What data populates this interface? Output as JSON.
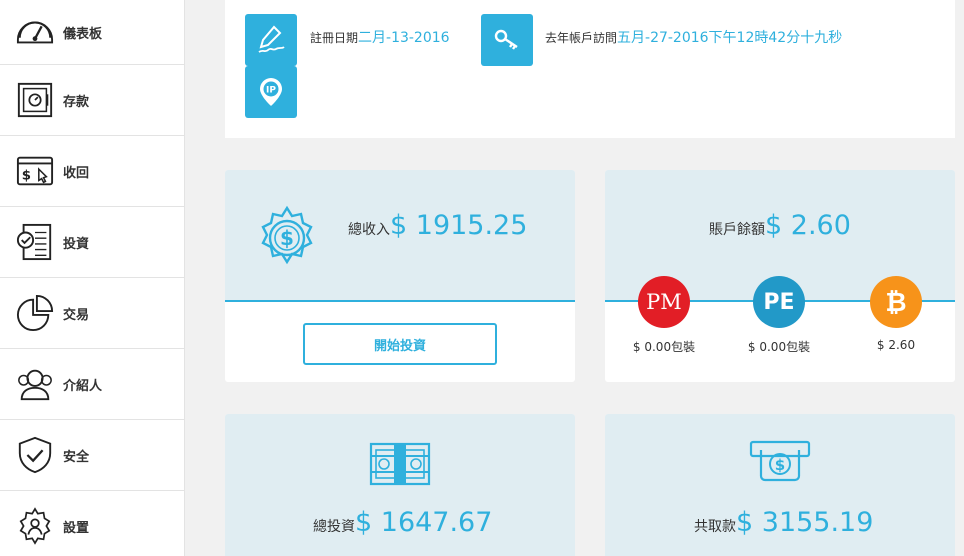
{
  "sidebar": {
    "items": [
      {
        "label": "儀表板",
        "icon": "speedometer-icon"
      },
      {
        "label": "存款",
        "icon": "safe-icon"
      },
      {
        "label": "收回",
        "icon": "withdraw-icon"
      },
      {
        "label": "投資",
        "icon": "checklist-icon"
      },
      {
        "label": "交易",
        "icon": "pie-chart-icon"
      },
      {
        "label": "介紹人",
        "icon": "users-icon"
      },
      {
        "label": "安全",
        "icon": "shield-check-icon"
      },
      {
        "label": "設置",
        "icon": "settings-user-icon"
      }
    ]
  },
  "account": {
    "reg_label": "註冊日期",
    "reg_value": "二月-13-2016",
    "last_label": "去年帳戶訪問",
    "last_value": "五月-27-2016下午12時42分十九秒",
    "ip_badge_text": "IP"
  },
  "earnings": {
    "label": "總收入",
    "amount": "$ 1915.25",
    "button": "開始投資"
  },
  "balance": {
    "label": "賬戶餘額",
    "amount": "$ 2.60",
    "coins": [
      {
        "symbol": "PM",
        "value": "$ 0.00包裝",
        "color": "#e21e26"
      },
      {
        "symbol": "PE",
        "value": "$ 0.00包裝",
        "color": "#2299c8"
      },
      {
        "symbol": "₿",
        "value": "$ 2.60",
        "color": "#f7931a"
      }
    ]
  },
  "invested": {
    "label": "總投資",
    "amount": "$ 1647.67"
  },
  "withdrawn": {
    "label": "共取款",
    "amount": "$ 3155.19"
  },
  "colors": {
    "accent": "#2fb0dd",
    "card_tint": "#e0edf2",
    "page_bg": "#f1f1f1"
  }
}
